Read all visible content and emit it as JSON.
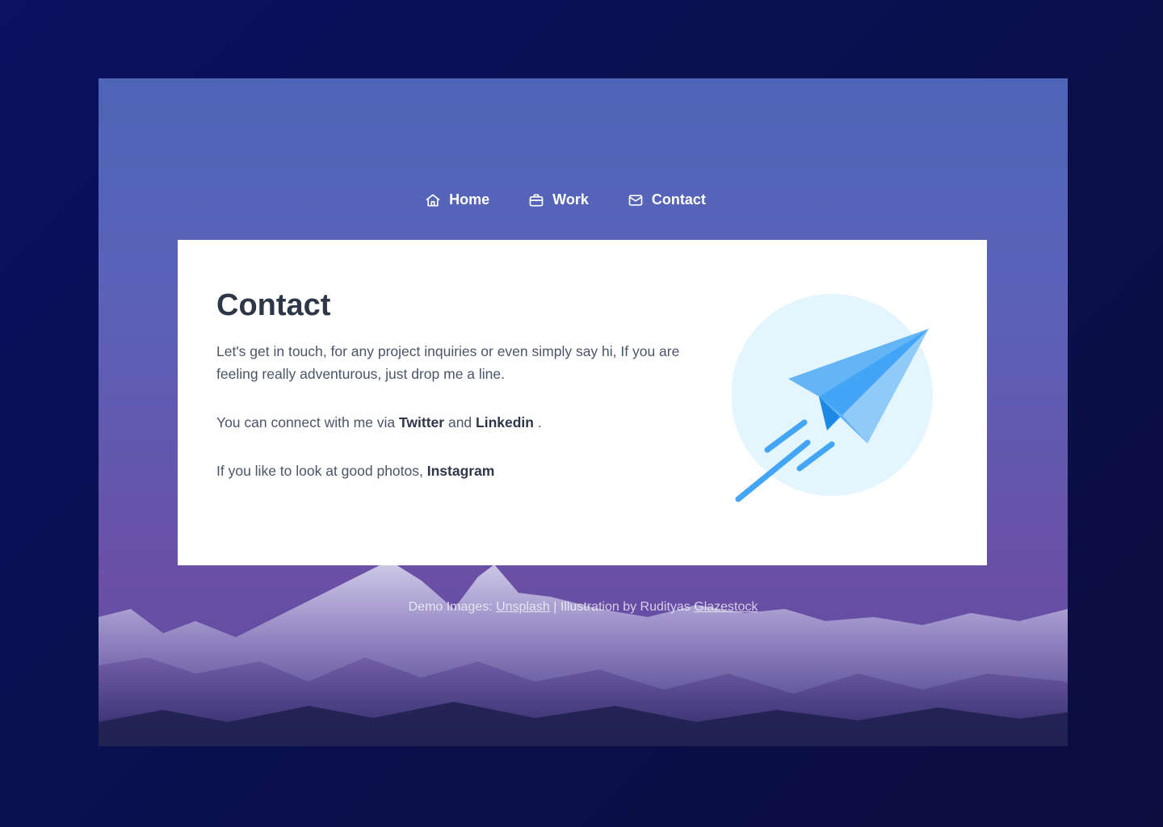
{
  "nav": {
    "items": [
      {
        "label": "Home",
        "icon": "home-icon"
      },
      {
        "label": "Work",
        "icon": "briefcase-icon"
      },
      {
        "label": "Contact",
        "icon": "mail-icon"
      }
    ]
  },
  "content": {
    "title": "Contact",
    "intro": "Let's get in touch, for any project inquiries or even simply say hi, If you are feeling really adventurous, just drop me a line.",
    "connect_prefix": "You can connect with me via ",
    "twitter": "Twitter",
    "and": " and ",
    "linkedin": "Linkedin",
    "connect_suffix": " .",
    "photos_prefix": "If you like to look at good photos, ",
    "instagram": "Instagram"
  },
  "footer": {
    "demo_prefix": "Demo Images: ",
    "unsplash": "Unsplash",
    "separator": " | Illustration by Rudityas ",
    "glazestock": "Glazestock"
  },
  "colors": {
    "page_bg": "#0b0f4f",
    "card_bg": "#ffffff",
    "heading": "#2d3748",
    "body_text": "#4a5568",
    "accent_blue": "#42a5f5",
    "illustration_circle": "#e3f5fd"
  }
}
